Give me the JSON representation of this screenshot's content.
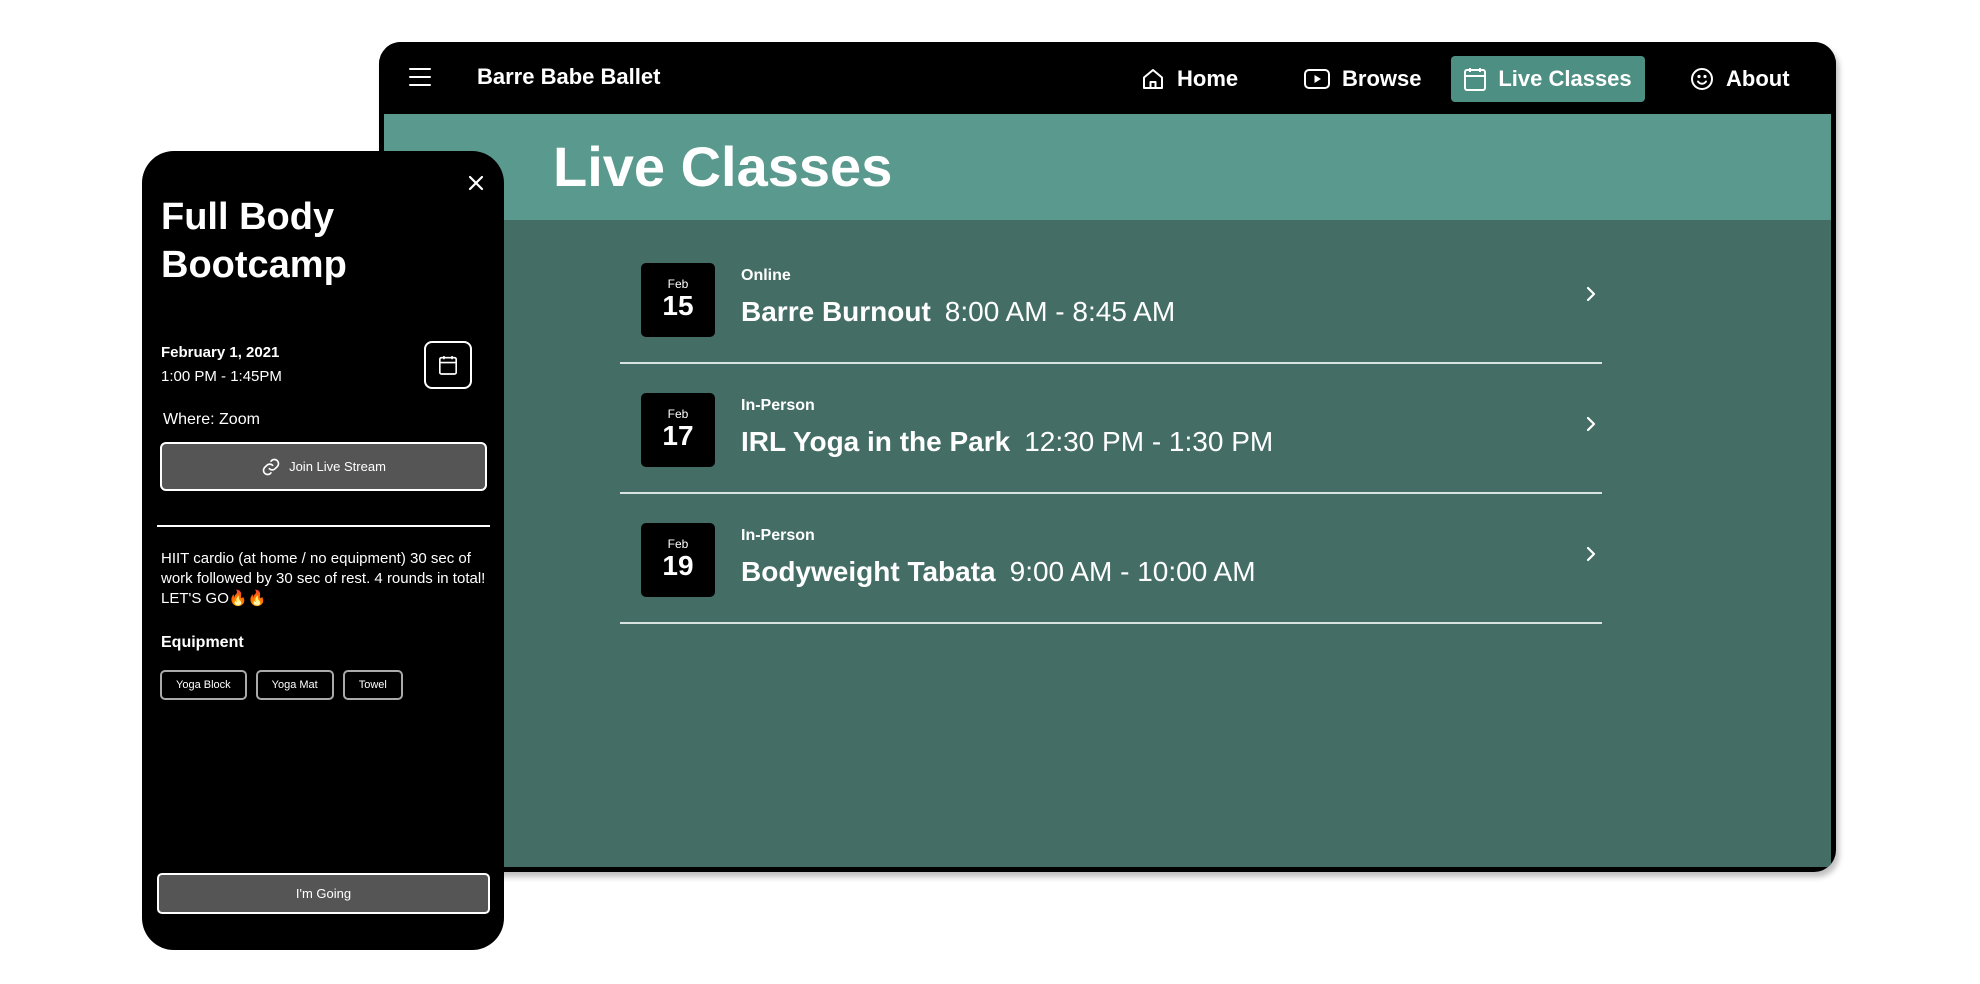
{
  "app": {
    "brand": "Barre Babe Ballet"
  },
  "nav": {
    "items": [
      {
        "label": "Home",
        "icon": "home-icon"
      },
      {
        "label": "Browse",
        "icon": "play-icon"
      },
      {
        "label": "Live Classes",
        "icon": "calendar-icon",
        "active": true
      },
      {
        "label": "About",
        "icon": "smiley-icon"
      }
    ]
  },
  "page": {
    "title": "Live Classes"
  },
  "classes": [
    {
      "month": "Feb",
      "day": "15",
      "type": "Online",
      "name": "Barre Burnout",
      "time": "8:00 AM - 8:45 AM"
    },
    {
      "month": "Feb",
      "day": "17",
      "type": "In-Person",
      "name": "IRL Yoga in the Park",
      "time": "12:30 PM - 1:30 PM"
    },
    {
      "month": "Feb",
      "day": "19",
      "type": "In-Person",
      "name": "Bodyweight Tabata",
      "time": "9:00 AM - 10:00 AM"
    }
  ],
  "detail": {
    "title": "Full Body Bootcamp",
    "date": "February 1, 2021",
    "time": "1:00 PM - 1:45PM",
    "where": "Where: Zoom",
    "join_label": "Join Live Stream",
    "description": "HIIT cardio (at home / no equipment) 30 sec of work followed by 30 sec of rest. 4 rounds in total! LET'S GO🔥🔥",
    "equipment_heading": "Equipment",
    "equipment": [
      "Yoga Block",
      "Yoga Mat",
      "Towel"
    ],
    "going_label": "I'm Going"
  },
  "colors": {
    "header_band": "#5a9a8e",
    "content_bg": "#446e65",
    "nav_active": "#4d8f83",
    "button_bg": "#555555"
  }
}
